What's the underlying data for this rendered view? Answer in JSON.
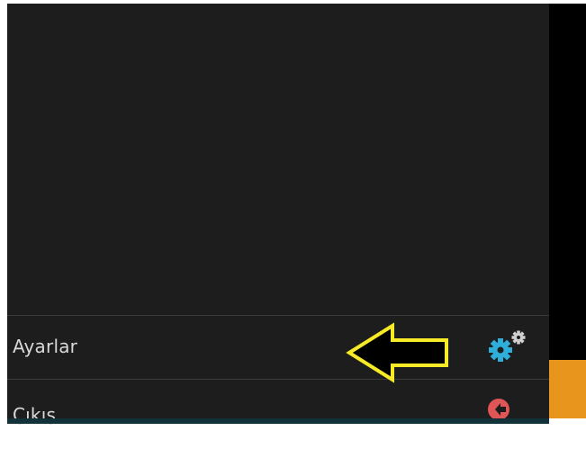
{
  "menu": {
    "items": [
      {
        "label": "Ayarlar",
        "icon": "gears-icon",
        "icon_color": "#2eaed8"
      },
      {
        "label": "Çıkış",
        "icon": "logout-icon",
        "icon_color": "#e05555"
      }
    ]
  },
  "annotation": {
    "icon": "left-arrow-icon",
    "color": "#f7ea27"
  },
  "colors": {
    "panel_bg": "#1d1d1d",
    "accent_orange": "#e7951d",
    "divider": "#3a3a3a"
  }
}
